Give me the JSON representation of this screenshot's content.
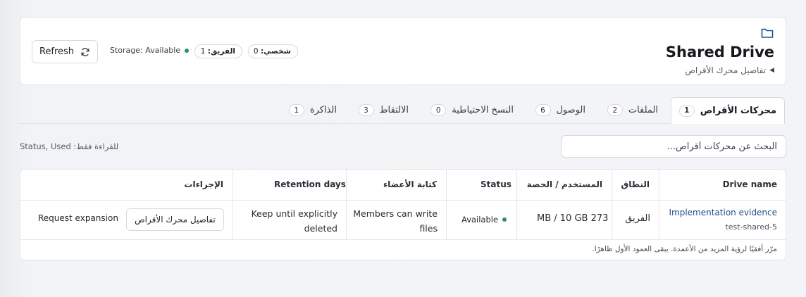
{
  "header": {
    "title": "Shared Drive",
    "breadcrumb": "تفاصيل محرك الأقراص",
    "refresh_label": "Refresh",
    "storage_status": "Storage: Available",
    "team_pill": {
      "label": "الفريق:",
      "value": "1"
    },
    "personal_pill": {
      "label": "شخصي:",
      "value": "0"
    }
  },
  "tabs": [
    {
      "label": "محركات الأقراص",
      "count": "1",
      "active": true
    },
    {
      "label": "الملفات",
      "count": "2"
    },
    {
      "label": "الوصول",
      "count": "6"
    },
    {
      "label": "النسخ الاحتياطية",
      "count": "0"
    },
    {
      "label": "الالتقاط",
      "count": "3"
    },
    {
      "label": "الذاكرة",
      "count": "1"
    }
  ],
  "search": {
    "placeholder": "البحث عن محركات أقراص..."
  },
  "readonly_note": "Status, Used :للقراءة فقط",
  "table": {
    "headers": {
      "drive_name": "Drive name",
      "scope": "النطاق",
      "used_quota": "المستخدم / الحصة",
      "status": "Status",
      "member_write": "كتابة الأعضاء",
      "retention": "Retention days",
      "actions": "الإجراءات"
    },
    "rows": [
      {
        "drive_name": "Implementation evidence",
        "drive_id": "test-shared-5",
        "scope": "الفريق",
        "used_quota": "273 MB / 10 GB",
        "status": "Available",
        "member_write_line1": "Members can write",
        "member_write_line2": "files",
        "retention_line1": "Keep until explicitly",
        "retention_line2": "deleted",
        "details_button": "تفاصيل محرك الأقراص",
        "request_button": "Request expansion"
      }
    ],
    "footnote": "مرّر أفقيًا لرؤية المزيد من الأعمدة. يبقى العمود الأول ظاهرًا."
  },
  "colors": {
    "status_green": "#2f8f55",
    "link_blue": "#1f4e89"
  }
}
